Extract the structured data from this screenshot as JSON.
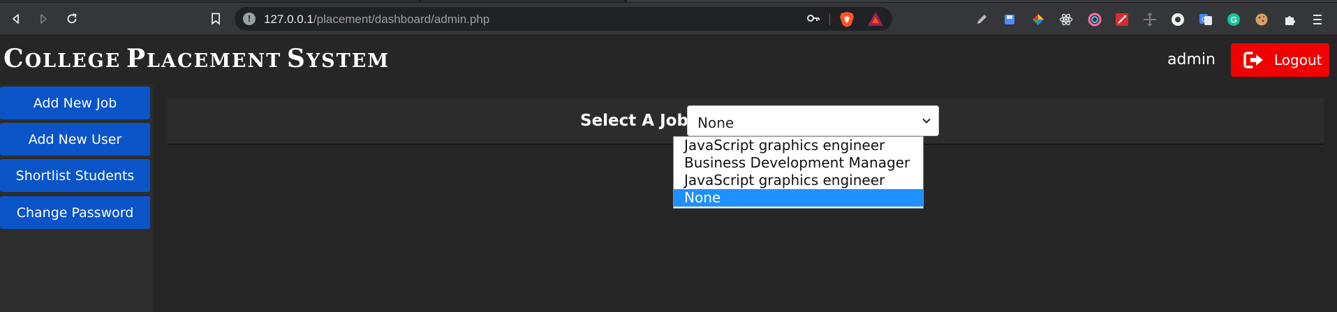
{
  "browser": {
    "url_host": "127.0.0.1",
    "url_path": "/placement/dashboard/admin.php"
  },
  "app": {
    "brand_word1_initial": "C",
    "brand_word1_rest": "OLLEGE",
    "brand_word2_initial": "P",
    "brand_word2_rest": "LACEMENT",
    "brand_word3_initial": "S",
    "brand_word3_rest": "YSTEM",
    "user": "admin",
    "logout_label": "Logout"
  },
  "sidebar": {
    "items": [
      {
        "label": "Add New Job"
      },
      {
        "label": "Add New User"
      },
      {
        "label": "Shortlist Students"
      },
      {
        "label": "Change Password"
      }
    ]
  },
  "job_filter": {
    "label": "Select A Job",
    "selected": "None",
    "options": [
      {
        "label": "JavaScript graphics engineer"
      },
      {
        "label": "Business Development Manager"
      },
      {
        "label": "JavaScript graphics engineer"
      },
      {
        "label": "None"
      }
    ]
  },
  "colors": {
    "accent_blue": "#0a54c8",
    "logout_red": "#f00000",
    "option_highlight": "#1e90ff"
  }
}
